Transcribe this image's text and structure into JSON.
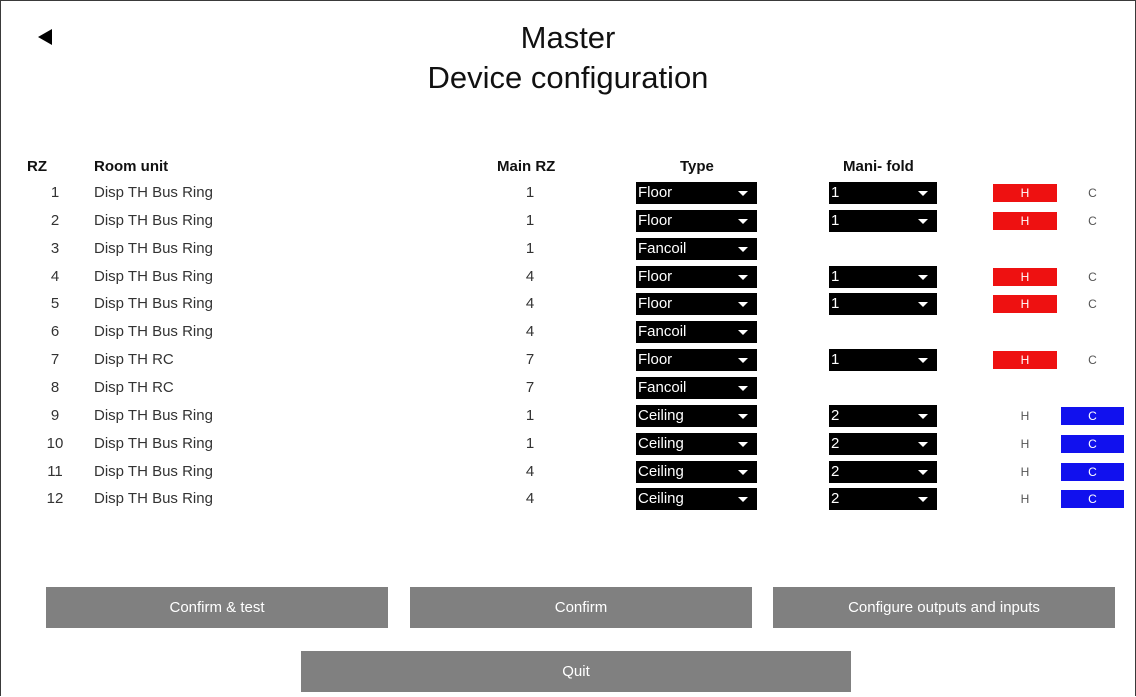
{
  "header": {
    "title_line1": "Master",
    "title_line2": "Device configuration"
  },
  "columns": {
    "rz": "RZ",
    "room_unit": "Room unit",
    "main_rz": "Main RZ",
    "type": "Type",
    "manifold": "Mani- fold"
  },
  "rows": [
    {
      "rz": "1",
      "room_unit": "Disp TH Bus Ring",
      "main_rz": "1",
      "type": "Floor",
      "manifold": "1",
      "mode": "H"
    },
    {
      "rz": "2",
      "room_unit": "Disp TH Bus Ring",
      "main_rz": "1",
      "type": "Floor",
      "manifold": "1",
      "mode": "H"
    },
    {
      "rz": "3",
      "room_unit": "Disp TH Bus Ring",
      "main_rz": "1",
      "type": "Fancoil",
      "manifold": null,
      "mode": null
    },
    {
      "rz": "4",
      "room_unit": "Disp TH Bus Ring",
      "main_rz": "4",
      "type": "Floor",
      "manifold": "1",
      "mode": "H"
    },
    {
      "rz": "5",
      "room_unit": "Disp TH Bus Ring",
      "main_rz": "4",
      "type": "Floor",
      "manifold": "1",
      "mode": "H"
    },
    {
      "rz": "6",
      "room_unit": "Disp TH Bus Ring",
      "main_rz": "4",
      "type": "Fancoil",
      "manifold": null,
      "mode": null
    },
    {
      "rz": "7",
      "room_unit": "Disp TH RC",
      "main_rz": "7",
      "type": "Floor",
      "manifold": "1",
      "mode": "H"
    },
    {
      "rz": "8",
      "room_unit": "Disp TH RC",
      "main_rz": "7",
      "type": "Fancoil",
      "manifold": null,
      "mode": null
    },
    {
      "rz": "9",
      "room_unit": "Disp TH Bus Ring",
      "main_rz": "1",
      "type": "Ceiling",
      "manifold": "2",
      "mode": "C"
    },
    {
      "rz": "10",
      "room_unit": "Disp TH Bus Ring",
      "main_rz": "1",
      "type": "Ceiling",
      "manifold": "2",
      "mode": "C"
    },
    {
      "rz": "11",
      "room_unit": "Disp TH Bus Ring",
      "main_rz": "4",
      "type": "Ceiling",
      "manifold": "2",
      "mode": "C"
    },
    {
      "rz": "12",
      "room_unit": "Disp TH Bus Ring",
      "main_rz": "4",
      "type": "Ceiling",
      "manifold": "2",
      "mode": "C"
    }
  ],
  "mode_labels": {
    "heat": "H",
    "cool": "C"
  },
  "colors": {
    "heat_active": "#ee1111",
    "cool_active": "#1111ee",
    "button_gray": "#808080",
    "select_bg": "#000000"
  },
  "buttons": {
    "confirm_test": "Confirm & test",
    "confirm": "Confirm",
    "configure": "Configure outputs and inputs",
    "quit": "Quit"
  },
  "icons": {
    "back": "back-arrow-icon",
    "dropdown": "chevron-down-icon"
  }
}
